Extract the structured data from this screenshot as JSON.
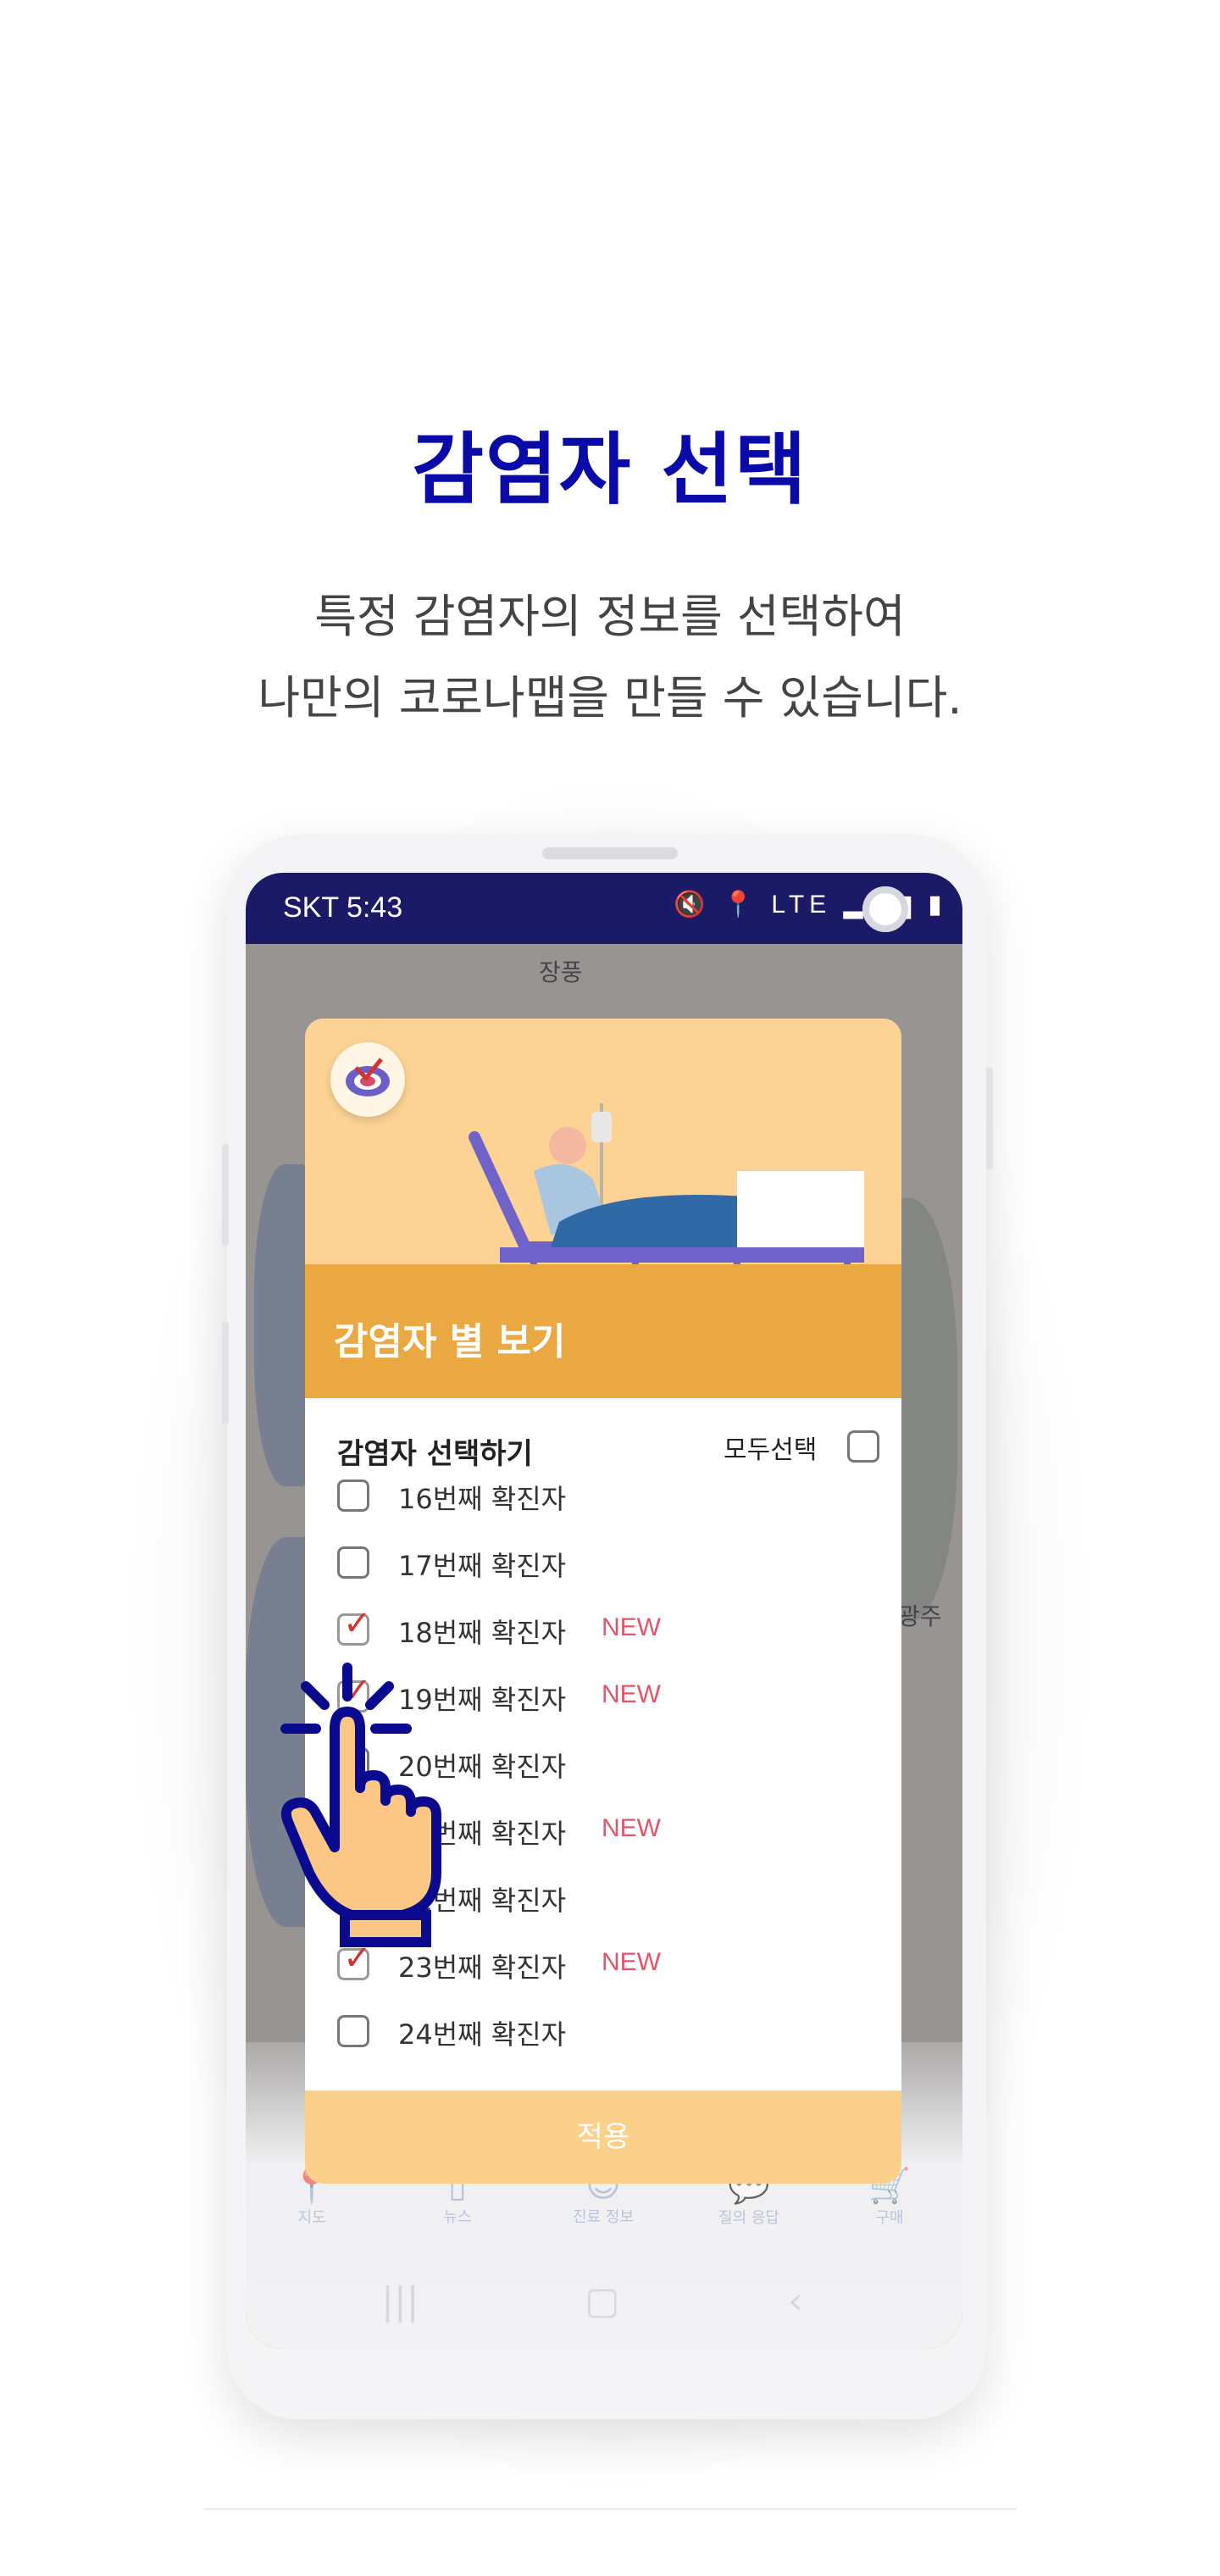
{
  "page": {
    "title": "감염자 선택",
    "subtitle_line1": "특정 감염자의 정보를 선택하여",
    "subtitle_line2": "나만의 코로나맵을 만들 수 있습니다."
  },
  "statusbar": {
    "carrier_time": "SKT 5:43",
    "icons": "🔇 📍 LTE ▂▄▆ ▮"
  },
  "map": {
    "labels": [
      "장풍",
      "광주"
    ]
  },
  "dialog": {
    "header_title": "감염자 별 보기",
    "section_title": "감염자 선택하기",
    "select_all_label": "모두선택",
    "apply_label": "적용",
    "rows": [
      {
        "label": "16번째 확진자",
        "checked": false,
        "new": ""
      },
      {
        "label": "17번째 확진자",
        "checked": false,
        "new": ""
      },
      {
        "label": "18번째 확진자",
        "checked": true,
        "new": "NEW"
      },
      {
        "label": "19번째 확진자",
        "checked": true,
        "new": "NEW"
      },
      {
        "label": "20번째 확진자",
        "checked": false,
        "new": ""
      },
      {
        "label": "21번째 확진자",
        "checked": true,
        "new": "NEW"
      },
      {
        "label": "22번째 확진자",
        "checked": false,
        "new": ""
      },
      {
        "label": "23번째 확진자",
        "checked": true,
        "new": "NEW"
      },
      {
        "label": "24번째 확진자",
        "checked": false,
        "new": ""
      }
    ]
  },
  "tabbar": {
    "items": [
      {
        "icon": "map-pin-icon",
        "label": "지도"
      },
      {
        "icon": "phone-icon",
        "label": "뉴스"
      },
      {
        "icon": "face-icon",
        "label": "진료 정보"
      },
      {
        "icon": "faq-icon",
        "label": "질의 응답"
      },
      {
        "icon": "cart-icon",
        "label": "구매"
      }
    ]
  },
  "colors": {
    "title": "#0a0aa8",
    "statusbar": "#1b1a66",
    "hero": "#fcd394",
    "band": "#eaa843",
    "new_tag": "#e0566a",
    "check": "#d23333",
    "hand_fill": "#fcc785",
    "hand_stroke": "#0a0a8e"
  }
}
